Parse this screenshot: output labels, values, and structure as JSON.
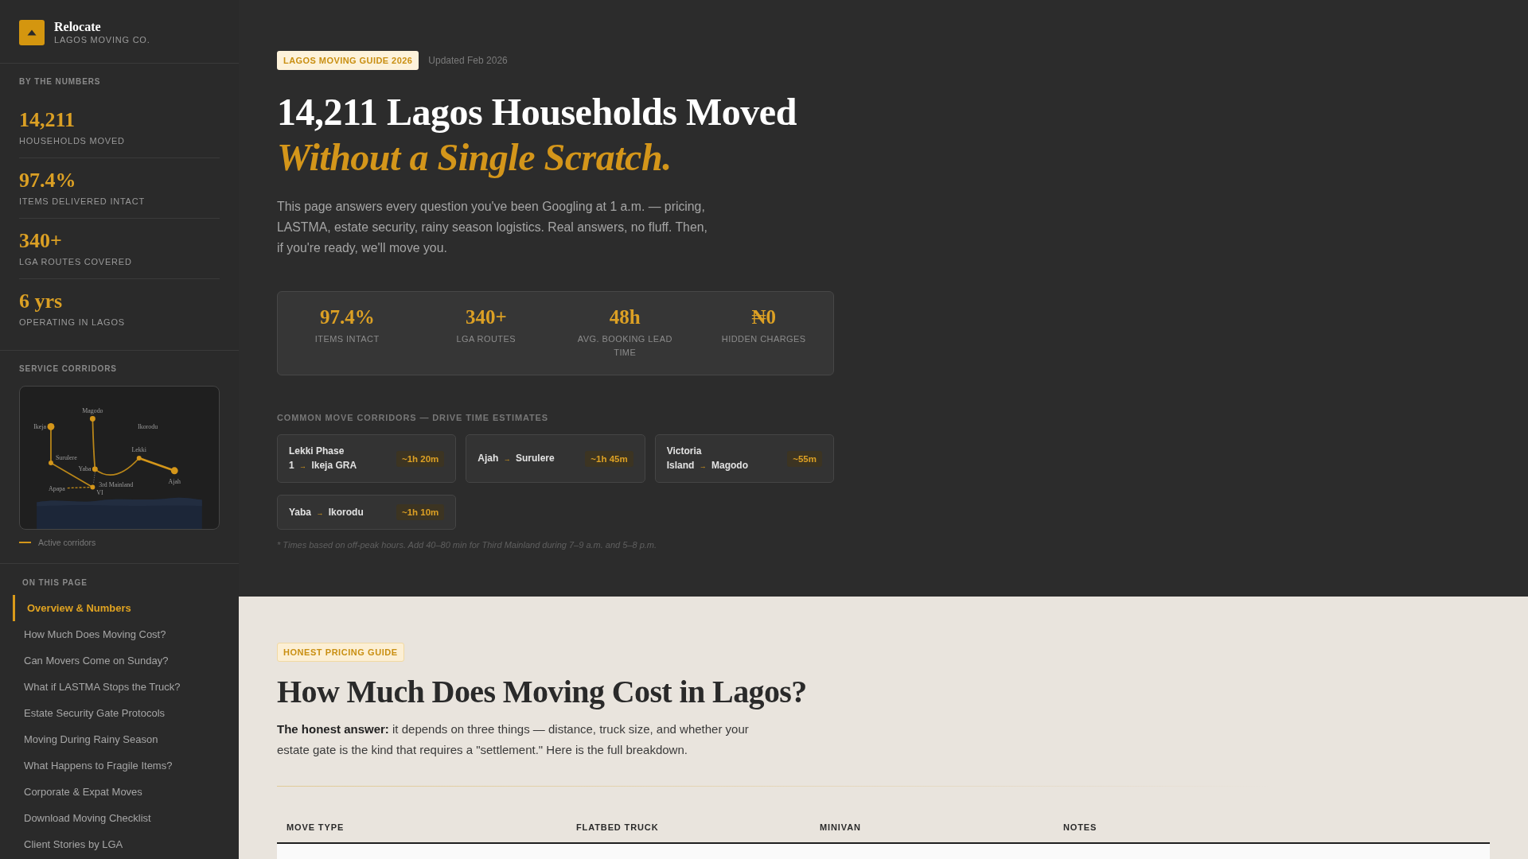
{
  "brand": {
    "name": "Relocate",
    "tagline": "LAGOS MOVING CO."
  },
  "sidebar": {
    "numbers_heading": "BY THE NUMBERS",
    "numbers": [
      {
        "value": "14,211",
        "label": "HOUSEHOLDS MOVED"
      },
      {
        "value": "97.4%",
        "label": "ITEMS DELIVERED INTACT"
      },
      {
        "value": "340+",
        "label": "LGA ROUTES COVERED"
      },
      {
        "value": "6 yrs",
        "label": "OPERATING IN LAGOS"
      }
    ],
    "corridors_heading": "SERVICE CORRIDORS",
    "map": {
      "places": [
        "Ikeja",
        "Magodo",
        "Ikorodu",
        "Surulere",
        "Yaba",
        "3rd Mainland",
        "Apapa",
        "VI",
        "Lekki",
        "Ajah"
      ]
    },
    "legend": "Active corridors",
    "nav_heading": "ON THIS PAGE",
    "nav": [
      {
        "label": "Overview & Numbers",
        "selected": true
      },
      {
        "label": "How Much Does Moving Cost?",
        "selected": false
      },
      {
        "label": "Can Movers Come on Sunday?",
        "selected": false
      },
      {
        "label": "What if LASTMA Stops the Truck?",
        "selected": false
      },
      {
        "label": "Estate Security Gate Protocols",
        "selected": false
      },
      {
        "label": "Moving During Rainy Season",
        "selected": false
      },
      {
        "label": "What Happens to Fragile Items?",
        "selected": false
      },
      {
        "label": "Corporate & Expat Moves",
        "selected": false
      },
      {
        "label": "Download Moving Checklist",
        "selected": false
      },
      {
        "label": "Client Stories by LGA",
        "selected": false
      }
    ]
  },
  "hero": {
    "badge": "LAGOS MOVING GUIDE 2026",
    "updated": "Updated Feb 2026",
    "title": "14,211 Lagos Households Moved",
    "title_accent": "Without a Single Scratch.",
    "intro": "This page answers every question you've been Googling at 1 a.m. — pricing, LASTMA, estate security, rainy season logistics. Real answers, no fluff. Then, if you're ready, we'll move you.",
    "stats": [
      {
        "value": "97.4%",
        "label": "ITEMS INTACT"
      },
      {
        "value": "340+",
        "label": "LGA ROUTES"
      },
      {
        "value": "48h",
        "label": "AVG. BOOKING LEAD TIME"
      },
      {
        "value": "₦0",
        "label": "HIDDEN CHARGES"
      }
    ],
    "corridors_heading": "COMMON MOVE CORRIDORS — DRIVE TIME ESTIMATES",
    "corridors": [
      {
        "from": "Lekki Phase 1",
        "arrow": "→",
        "to": "Ikeja GRA",
        "time": "~1h 20m"
      },
      {
        "from": "Ajah",
        "arrow": "→",
        "to": "Surulere",
        "time": "~1h 45m"
      },
      {
        "from": "Victoria Island",
        "arrow": "→",
        "to": "Magodo",
        "time": "~55m"
      },
      {
        "from": "Yaba",
        "arrow": "→",
        "to": "Ikorodu",
        "time": "~1h 10m"
      }
    ],
    "footnote": "* Times based on off-peak hours. Add 40–80 min for Third Mainland during 7–9 a.m. and 5–8 p.m."
  },
  "pricing": {
    "badge": "HONEST PRICING GUIDE",
    "title": "How Much Does Moving Cost in Lagos?",
    "intro": "**The honest answer:** it depends on three things — distance, truck size, and whether your estate gate is the kind that requires a \"settlement.\" Here is the full breakdown.",
    "table": {
      "columns": [
        "MOVE TYPE",
        "FLATBED TRUCK",
        "MINIVAN",
        "NOTES"
      ]
    }
  }
}
